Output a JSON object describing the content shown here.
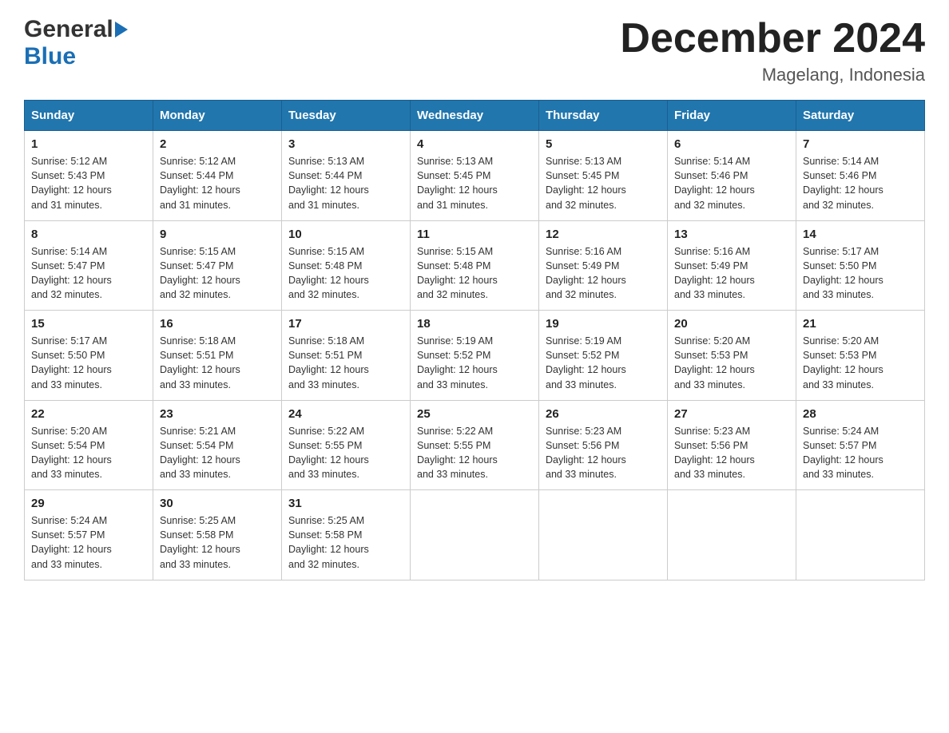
{
  "header": {
    "logo_general": "General",
    "logo_blue": "Blue",
    "month_title": "December 2024",
    "location": "Magelang, Indonesia"
  },
  "days_of_week": [
    "Sunday",
    "Monday",
    "Tuesday",
    "Wednesday",
    "Thursday",
    "Friday",
    "Saturday"
  ],
  "weeks": [
    [
      {
        "num": "1",
        "sunrise": "5:12 AM",
        "sunset": "5:43 PM",
        "daylight": "12 hours and 31 minutes."
      },
      {
        "num": "2",
        "sunrise": "5:12 AM",
        "sunset": "5:44 PM",
        "daylight": "12 hours and 31 minutes."
      },
      {
        "num": "3",
        "sunrise": "5:13 AM",
        "sunset": "5:44 PM",
        "daylight": "12 hours and 31 minutes."
      },
      {
        "num": "4",
        "sunrise": "5:13 AM",
        "sunset": "5:45 PM",
        "daylight": "12 hours and 31 minutes."
      },
      {
        "num": "5",
        "sunrise": "5:13 AM",
        "sunset": "5:45 PM",
        "daylight": "12 hours and 32 minutes."
      },
      {
        "num": "6",
        "sunrise": "5:14 AM",
        "sunset": "5:46 PM",
        "daylight": "12 hours and 32 minutes."
      },
      {
        "num": "7",
        "sunrise": "5:14 AM",
        "sunset": "5:46 PM",
        "daylight": "12 hours and 32 minutes."
      }
    ],
    [
      {
        "num": "8",
        "sunrise": "5:14 AM",
        "sunset": "5:47 PM",
        "daylight": "12 hours and 32 minutes."
      },
      {
        "num": "9",
        "sunrise": "5:15 AM",
        "sunset": "5:47 PM",
        "daylight": "12 hours and 32 minutes."
      },
      {
        "num": "10",
        "sunrise": "5:15 AM",
        "sunset": "5:48 PM",
        "daylight": "12 hours and 32 minutes."
      },
      {
        "num": "11",
        "sunrise": "5:15 AM",
        "sunset": "5:48 PM",
        "daylight": "12 hours and 32 minutes."
      },
      {
        "num": "12",
        "sunrise": "5:16 AM",
        "sunset": "5:49 PM",
        "daylight": "12 hours and 32 minutes."
      },
      {
        "num": "13",
        "sunrise": "5:16 AM",
        "sunset": "5:49 PM",
        "daylight": "12 hours and 33 minutes."
      },
      {
        "num": "14",
        "sunrise": "5:17 AM",
        "sunset": "5:50 PM",
        "daylight": "12 hours and 33 minutes."
      }
    ],
    [
      {
        "num": "15",
        "sunrise": "5:17 AM",
        "sunset": "5:50 PM",
        "daylight": "12 hours and 33 minutes."
      },
      {
        "num": "16",
        "sunrise": "5:18 AM",
        "sunset": "5:51 PM",
        "daylight": "12 hours and 33 minutes."
      },
      {
        "num": "17",
        "sunrise": "5:18 AM",
        "sunset": "5:51 PM",
        "daylight": "12 hours and 33 minutes."
      },
      {
        "num": "18",
        "sunrise": "5:19 AM",
        "sunset": "5:52 PM",
        "daylight": "12 hours and 33 minutes."
      },
      {
        "num": "19",
        "sunrise": "5:19 AM",
        "sunset": "5:52 PM",
        "daylight": "12 hours and 33 minutes."
      },
      {
        "num": "20",
        "sunrise": "5:20 AM",
        "sunset": "5:53 PM",
        "daylight": "12 hours and 33 minutes."
      },
      {
        "num": "21",
        "sunrise": "5:20 AM",
        "sunset": "5:53 PM",
        "daylight": "12 hours and 33 minutes."
      }
    ],
    [
      {
        "num": "22",
        "sunrise": "5:20 AM",
        "sunset": "5:54 PM",
        "daylight": "12 hours and 33 minutes."
      },
      {
        "num": "23",
        "sunrise": "5:21 AM",
        "sunset": "5:54 PM",
        "daylight": "12 hours and 33 minutes."
      },
      {
        "num": "24",
        "sunrise": "5:22 AM",
        "sunset": "5:55 PM",
        "daylight": "12 hours and 33 minutes."
      },
      {
        "num": "25",
        "sunrise": "5:22 AM",
        "sunset": "5:55 PM",
        "daylight": "12 hours and 33 minutes."
      },
      {
        "num": "26",
        "sunrise": "5:23 AM",
        "sunset": "5:56 PM",
        "daylight": "12 hours and 33 minutes."
      },
      {
        "num": "27",
        "sunrise": "5:23 AM",
        "sunset": "5:56 PM",
        "daylight": "12 hours and 33 minutes."
      },
      {
        "num": "28",
        "sunrise": "5:24 AM",
        "sunset": "5:57 PM",
        "daylight": "12 hours and 33 minutes."
      }
    ],
    [
      {
        "num": "29",
        "sunrise": "5:24 AM",
        "sunset": "5:57 PM",
        "daylight": "12 hours and 33 minutes."
      },
      {
        "num": "30",
        "sunrise": "5:25 AM",
        "sunset": "5:58 PM",
        "daylight": "12 hours and 33 minutes."
      },
      {
        "num": "31",
        "sunrise": "5:25 AM",
        "sunset": "5:58 PM",
        "daylight": "12 hours and 32 minutes."
      },
      null,
      null,
      null,
      null
    ]
  ],
  "labels": {
    "sunrise": "Sunrise:",
    "sunset": "Sunset:",
    "daylight": "Daylight:"
  }
}
